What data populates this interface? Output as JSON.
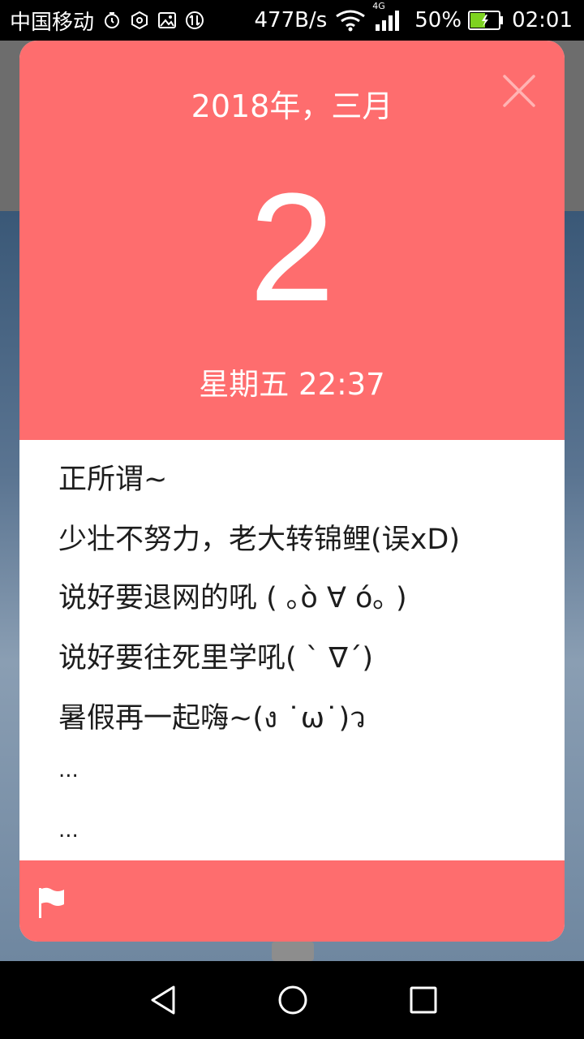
{
  "status_bar": {
    "carrier": "中国移动",
    "net_speed": "477B/s",
    "network_type": "4G",
    "battery": "50%",
    "time": "02:01",
    "icons": [
      "alarm-icon",
      "settings-icon",
      "image-icon",
      "sync-icon",
      "wifi-icon",
      "signal-icon",
      "battery-icon"
    ]
  },
  "card": {
    "month_title": "2018年，三月",
    "day": "2",
    "weekday_time": "星期五 22:37",
    "note_lines": [
      "正所谓~",
      "少壮不努力，老大转锦鲤(误xD)",
      "说好要退网的吼 ( ｡ò ∀ ó｡ )",
      "说好要往死里学吼( ` ∇´)",
      "暑假再一起嗨~(ง ˙ω˙)ว",
      "...",
      "..."
    ],
    "header_color": "#fe6d6e",
    "footer_icon": "flag-icon",
    "close_icon": "close-icon"
  },
  "nav_bar": {
    "icons": [
      "back-icon",
      "home-icon",
      "recents-icon"
    ]
  }
}
